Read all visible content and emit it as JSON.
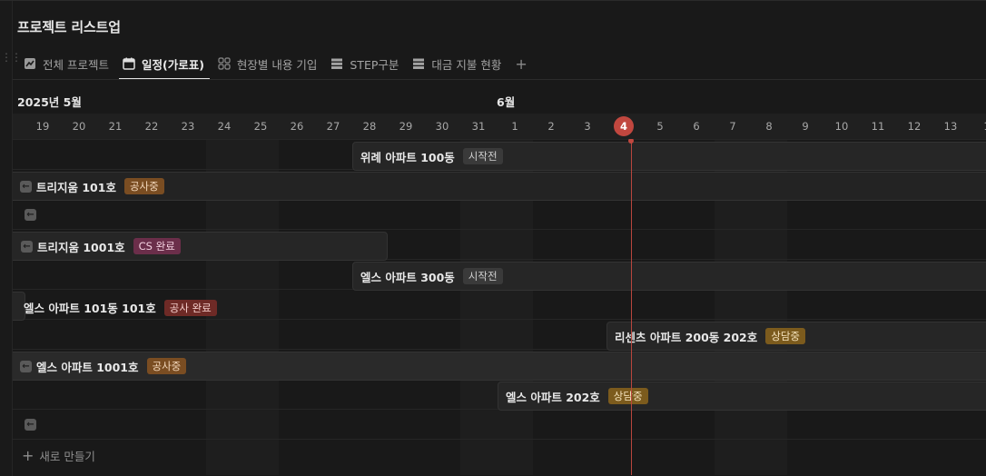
{
  "page": {
    "title": "프로젝트 리스트업"
  },
  "tabs": [
    {
      "label": "전체 프로젝트",
      "icon": "chart-line-icon"
    },
    {
      "label": "일정(가로표)",
      "icon": "calendar-icon",
      "active": true
    },
    {
      "label": "현장별 내용 기입",
      "icon": "grid-icon"
    },
    {
      "label": "STEP구분",
      "icon": "table-icon"
    },
    {
      "label": "대금 지불 현황",
      "icon": "table-icon"
    }
  ],
  "tab_add_label": "+",
  "timeline": {
    "month_may": "2025년 5월",
    "month_june": "6월",
    "days": [
      "19",
      "20",
      "21",
      "22",
      "23",
      "24",
      "25",
      "26",
      "27",
      "28",
      "29",
      "30",
      "31",
      "1",
      "2",
      "3",
      "4",
      "5",
      "6",
      "7",
      "8",
      "9",
      "10",
      "11",
      "12",
      "13",
      "1"
    ],
    "today": "4"
  },
  "rows": [
    {
      "name": "위례 아파트 100동",
      "status": "시작전",
      "status_color": "gray"
    },
    {
      "name": "트리지움 101호",
      "status": "공사중",
      "status_color": "orange"
    },
    {
      "name": "",
      "status": ""
    },
    {
      "name": "트리지움 1001호",
      "status": "CS 완료",
      "status_color": "pink"
    },
    {
      "name": "엘스 아파트 300동",
      "status": "시작전",
      "status_color": "gray"
    },
    {
      "name": "엘스 아파트 101동 101호",
      "status": "공사 완료",
      "status_color": "red"
    },
    {
      "name": "리센츠 아파트 200동 202호",
      "status": "상담중",
      "status_color": "yellow"
    },
    {
      "name": "엘스 아파트 1001호",
      "status": "공사중",
      "status_color": "orange"
    },
    {
      "name": "엘스 아파트 202호",
      "status": "상담중",
      "status_color": "yellow"
    },
    {
      "name": "",
      "status": ""
    }
  ],
  "new_row_label": "새로 만들기",
  "colors": {
    "background": "#191919",
    "today": "#c1473f"
  }
}
